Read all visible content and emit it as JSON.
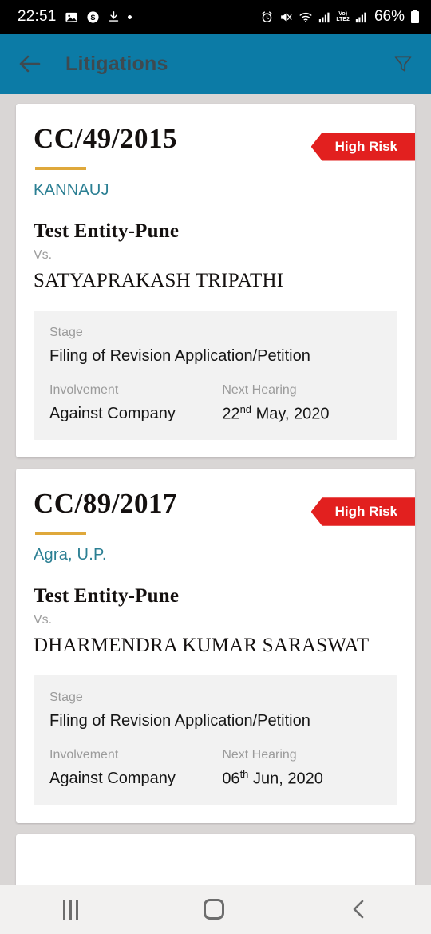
{
  "statusbar": {
    "time": "22:51",
    "battery_percent": "66%",
    "left_icons": [
      "gallery-icon",
      "skype-icon",
      "download-icon",
      "dot-indicator"
    ],
    "right_icons": [
      "alarm-icon",
      "mute-icon",
      "wifi-icon",
      "signal-icon",
      "volte-lte2-icon",
      "signal2-icon",
      "battery-icon"
    ],
    "volte_top": "Vo)",
    "volte_bottom": "LTE2"
  },
  "appbar": {
    "title": "Litigations",
    "back_icon": "back-arrow-icon",
    "filter_icon": "filter-funnel-icon",
    "background_color": "#0c7ba6",
    "title_color": "#3e4a50"
  },
  "colors": {
    "page_background": "#d9d6d5",
    "card_background": "#ffffff",
    "risk_badge": "#e2201f",
    "gold_rule": "#dfa83b",
    "court_text": "#2b7f93",
    "panel_background": "#f2f2f2"
  },
  "labels": {
    "vs": "Vs.",
    "stage": "Stage",
    "involvement": "Involvement",
    "next_hearing": "Next Hearing"
  },
  "cards": [
    {
      "case_number": "CC/49/2015",
      "risk": "High Risk",
      "court": "KANNAUJ",
      "party_a": "Test Entity-Pune",
      "party_b": "SATYAPRAKASH TRIPATHI",
      "stage": "Filing of Revision Application/Petition",
      "involvement": "Against Company",
      "hearing_day": "22",
      "hearing_suffix": "nd",
      "hearing_rest": "May, 2020"
    },
    {
      "case_number": "CC/89/2017",
      "risk": "High Risk",
      "court": "Agra, U.P.",
      "party_a": "Test Entity-Pune",
      "party_b": "DHARMENDRA KUMAR SARASWAT",
      "stage": "Filing of Revision Application/Petition",
      "involvement": "Against Company",
      "hearing_day": "06",
      "hearing_suffix": "th",
      "hearing_rest": "Jun, 2020"
    }
  ],
  "navbar": {
    "recents_icon": "recents-icon",
    "home_icon": "home-icon",
    "back_icon": "back-chevron-icon"
  }
}
